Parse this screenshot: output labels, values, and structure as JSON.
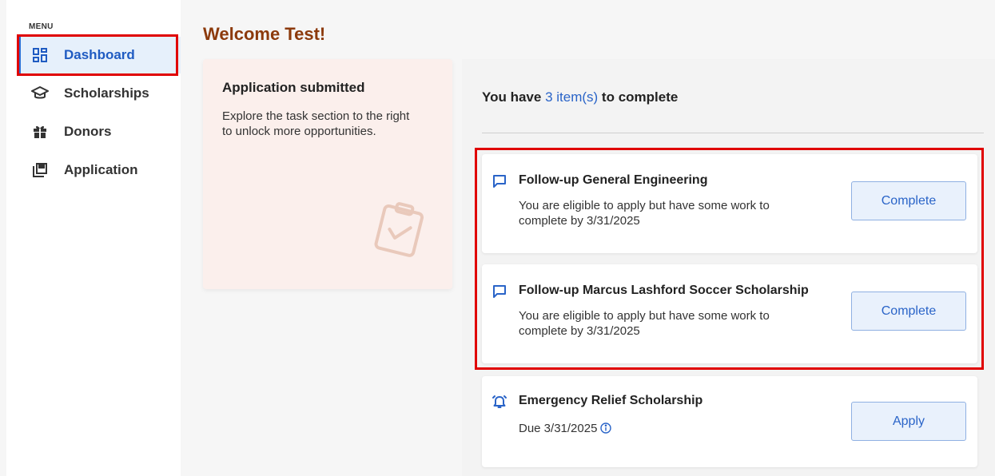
{
  "sidebar": {
    "menu_label": "MENU",
    "items": [
      {
        "label": "Dashboard",
        "icon": "dashboard-icon",
        "active": true
      },
      {
        "label": "Scholarships",
        "icon": "graduation-cap-icon",
        "active": false
      },
      {
        "label": "Donors",
        "icon": "gift-icon",
        "active": false
      },
      {
        "label": "Application",
        "icon": "application-icon",
        "active": false
      }
    ]
  },
  "main": {
    "welcome": "Welcome Test!",
    "application_card": {
      "title": "Application submitted",
      "description": "Explore the task section to the right to unlock more opportunities.",
      "icon": "clipboard-check-icon"
    },
    "tasks": {
      "heading_prefix": "You have",
      "count_text": "3 item(s)",
      "heading_suffix": "to complete",
      "items": [
        {
          "icon": "chat-icon",
          "title": "Follow-up General Engineering",
          "description": "You are eligible to apply but have some work to complete by 3/31/2025",
          "button": "Complete"
        },
        {
          "icon": "chat-icon",
          "title": "Follow-up Marcus Lashford Soccer Scholarship",
          "description": "You are eligible to apply but have some work to complete by 3/31/2025",
          "button": "Complete"
        },
        {
          "icon": "bell-icon",
          "title": "Emergency Relief Scholarship",
          "description": "Due 3/31/2025",
          "button": "Apply"
        }
      ]
    }
  },
  "colors": {
    "accent": "#2a64c8",
    "welcome": "#8c3a0c",
    "highlight": "#e00000",
    "card_bg": "#fbefec"
  }
}
